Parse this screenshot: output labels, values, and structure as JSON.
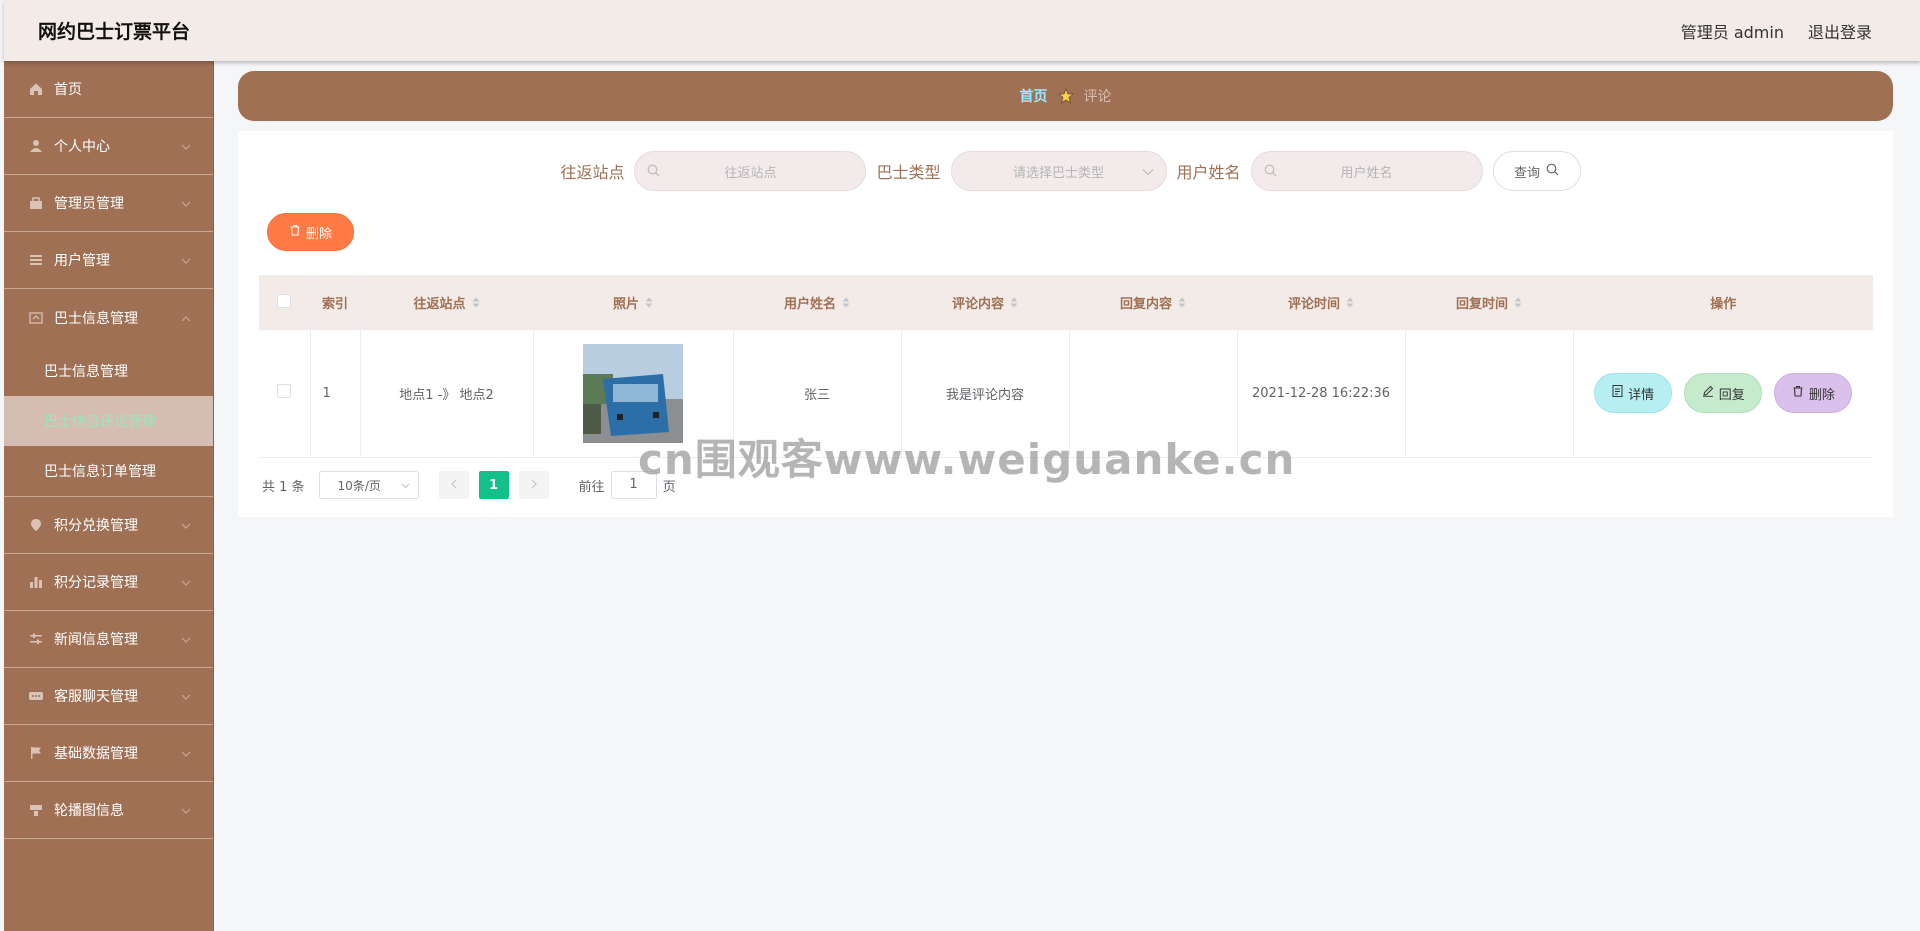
{
  "app": {
    "title": "网约巴士订票平台"
  },
  "header": {
    "user_label": "管理员 admin",
    "logout_label": "退出登录"
  },
  "sidebar": {
    "items": [
      {
        "label": "首页",
        "icon": "home-icon"
      },
      {
        "label": "个人中心",
        "icon": "user-icon"
      },
      {
        "label": "管理员管理",
        "icon": "admin-icon"
      },
      {
        "label": "用户管理",
        "icon": "list-icon"
      },
      {
        "label": "巴士信息管理",
        "icon": "bus-info-icon",
        "expanded": true,
        "children": [
          {
            "label": "巴士信息管理"
          },
          {
            "label": "巴士信息评论管理",
            "active": true
          },
          {
            "label": "巴士信息订单管理"
          }
        ]
      },
      {
        "label": "积分兑换管理",
        "icon": "location-icon"
      },
      {
        "label": "积分记录管理",
        "icon": "chart-icon"
      },
      {
        "label": "新闻信息管理",
        "icon": "sliders-icon"
      },
      {
        "label": "客服聊天管理",
        "icon": "chat-icon"
      },
      {
        "label": "基础数据管理",
        "icon": "flag-icon"
      },
      {
        "label": "轮播图信息",
        "icon": "carousel-icon"
      }
    ]
  },
  "breadcrumb": {
    "home": "首页",
    "current": "评论"
  },
  "search": {
    "station_label": "往返站点",
    "station_placeholder": "往返站点",
    "bustype_label": "巴士类型",
    "bustype_placeholder": "请选择巴士类型",
    "username_label": "用户姓名",
    "username_placeholder": "用户姓名",
    "query_label": "查询"
  },
  "actions": {
    "delete_label": "删除"
  },
  "table": {
    "columns": [
      "索引",
      "往返站点",
      "照片",
      "用户姓名",
      "评论内容",
      "回复内容",
      "评论时间",
      "回复时间",
      "操作"
    ],
    "rows": [
      {
        "index": "1",
        "station": "地点1 -》 地点2",
        "photo": "bus-photo",
        "username": "张三",
        "comment": "我是评论内容",
        "reply": "",
        "comment_time": "2021-12-28 16:22:36",
        "reply_time": ""
      }
    ],
    "op_labels": {
      "detail": "详情",
      "reply": "回复",
      "delete": "删除"
    }
  },
  "pagination": {
    "total": "共 1 条",
    "page_size": "10条/页",
    "current_page": "1",
    "goto_prefix": "前往",
    "goto_value": "1",
    "goto_suffix": "页"
  },
  "watermark": "cn围观客www.weiguanke.cn",
  "colors": {
    "primary": "#a07055",
    "header_bg": "#f3ebe8",
    "active_page": "#13c08a",
    "delete_btn": "#ff7a45"
  }
}
